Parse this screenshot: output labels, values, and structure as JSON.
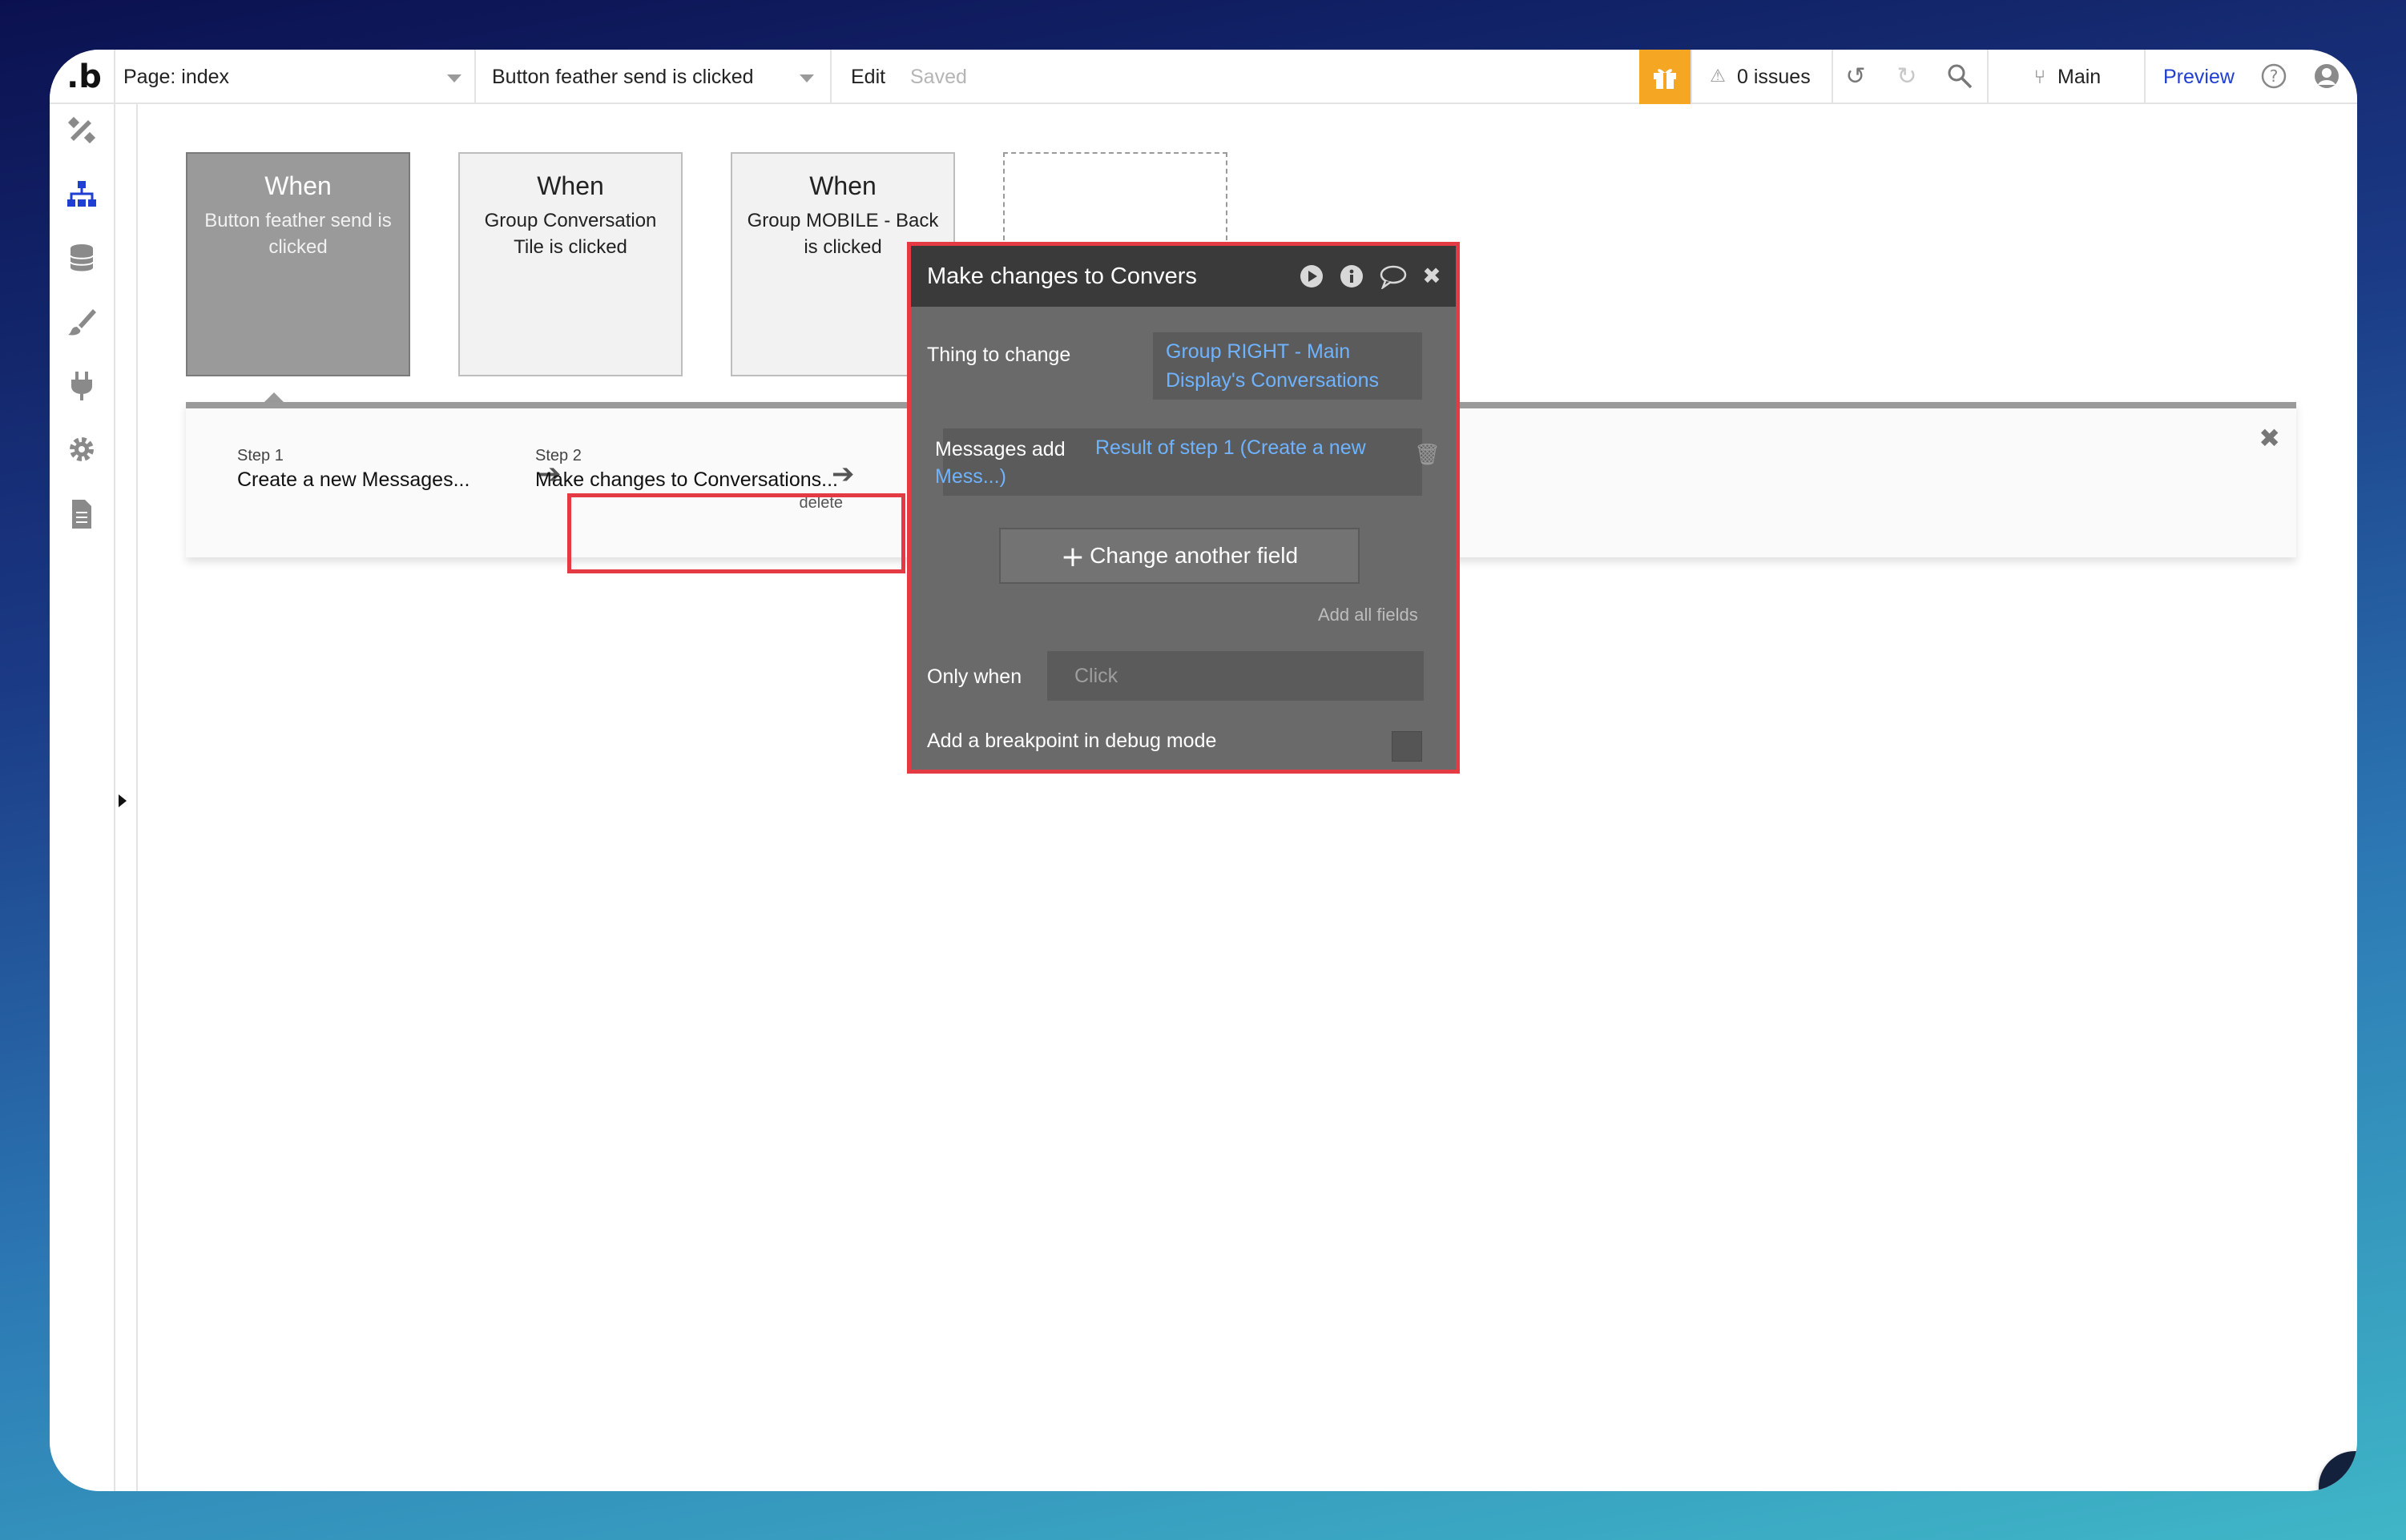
{
  "topbar": {
    "logo": ".b",
    "page_selector": "Page: index",
    "event_selector": "Button feather send is clicked",
    "edit_label": "Edit",
    "saved_label": "Saved",
    "issues_label": "0 issues",
    "branch_label": "Main",
    "preview_label": "Preview"
  },
  "sidebar": {
    "items": [
      "design-icon",
      "workflow-icon",
      "data-icon",
      "styles-icon",
      "plugins-icon",
      "settings-icon",
      "logs-icon"
    ]
  },
  "events": [
    {
      "when": "When",
      "desc": "Button feather send is clicked",
      "selected": true
    },
    {
      "when": "When",
      "desc": "Group Conversation Tile is clicked",
      "selected": false
    },
    {
      "when": "When",
      "desc": "Group MOBILE - Back is clicked",
      "selected": false
    }
  ],
  "steps": [
    {
      "num": "Step 1",
      "title": "Create a new Messages..."
    },
    {
      "num": "Step 2",
      "title": "Make changes to Conversations...",
      "delete": "delete"
    }
  ],
  "panel": {
    "title": "Make changes to Convers",
    "thing_label": "Thing to change",
    "thing_value_line1": "Group RIGHT - Main",
    "thing_value_line2": "Display's Conversations",
    "field_label": "Messages add",
    "field_value_line1": "Result of step 1 (Create a new",
    "field_value_line2": "Mess...)",
    "change_button": "Change another field",
    "add_all": "Add all fields",
    "only_when_label": "Only when",
    "only_when_placeholder": "Click",
    "breakpoint_label": "Add a breakpoint in debug mode"
  },
  "colors": {
    "accent": "#1e3fd1",
    "highlight": "#e43a43",
    "gift": "#f5a623",
    "link": "#6fb3ff"
  }
}
